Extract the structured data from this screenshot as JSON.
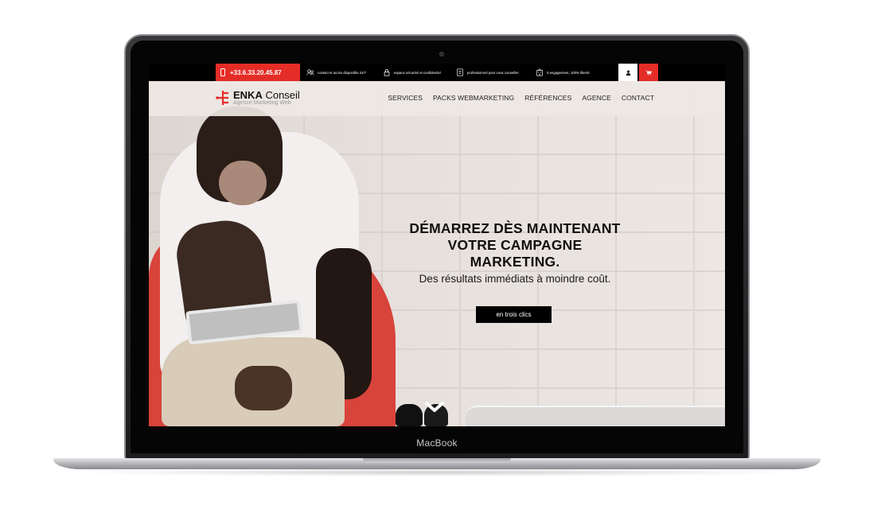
{
  "device": {
    "brand_label": "MacBook"
  },
  "topbar": {
    "phone": "+33.6.33.20.45.87",
    "features": [
      {
        "icon": "people-icon",
        "label": "contact et accès disponible 24/7"
      },
      {
        "icon": "lock-icon",
        "label": "espace sécurisé et confidentiel"
      },
      {
        "icon": "document-icon",
        "label": "professionnel pour vous conseiller"
      },
      {
        "icon": "building-icon",
        "label": "0 engagement, 100% liberté"
      }
    ],
    "user_icon": "user-icon",
    "cart_icon": "cart-icon",
    "accent_color": "#e52d27"
  },
  "brand": {
    "name_bold": "ENKA",
    "name_light": " Conseil",
    "tagline": "Agence Marketing Web"
  },
  "nav": {
    "items": [
      "SERVICES",
      "PACKS WEBMARKETING",
      "RÉFÉRENCES",
      "AGENCE",
      "CONTACT"
    ]
  },
  "hero": {
    "headline_lines": [
      "DÉMARREZ DÈS MAINTENANT",
      "VOTRE CAMPAGNE",
      "MARKETING."
    ],
    "subline": "Des résultats immédiats à moindre coût.",
    "cta_label": "en trois clics",
    "scroll_icon": "chevron-down-icon"
  }
}
